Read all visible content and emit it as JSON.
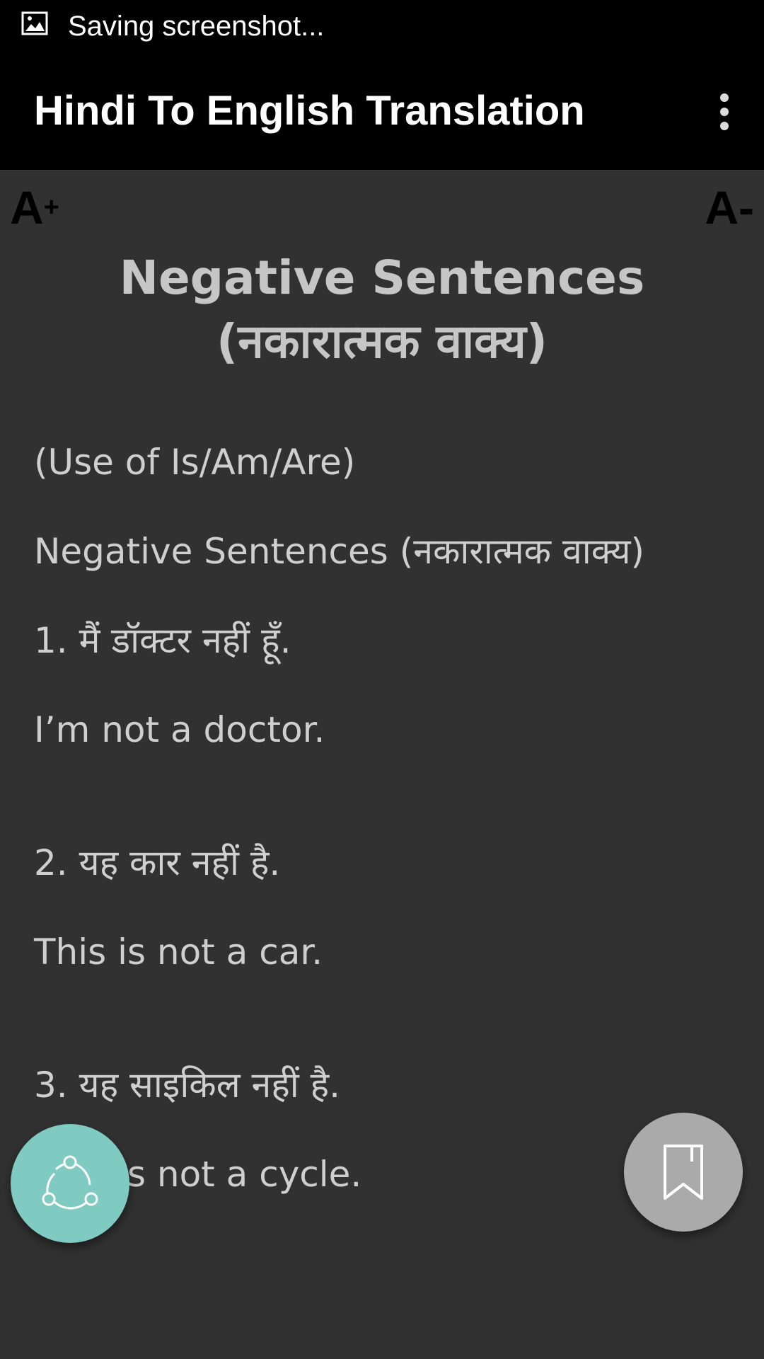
{
  "status_bar": {
    "text": "Saving screenshot...",
    "icon": "image-icon"
  },
  "app_bar": {
    "title": "Hindi To English Translation",
    "menu_icon": "more-vertical-icon"
  },
  "font_controls": {
    "increase_label": "A",
    "increase_symbol": "+",
    "decrease_label": "A-"
  },
  "content": {
    "title_line1": "Negative Sentences",
    "title_line2": "(नकारात्मक वाक्य)",
    "lines": [
      "(Use of Is/Am/Are)",
      "Negative Sentences (नकारात्मक वाक्य)",
      "1. मैं डॉक्टर नहीं हूँ.",
      "I’m not a doctor.",
      "2. यह कार नहीं है.",
      "This is not a car.",
      "3. यह साइकिल नहीं है.",
      "This is not a cycle."
    ]
  },
  "fabs": {
    "share_icon": "share-icon",
    "share_color": "#7fcbc1",
    "bookmark_icon": "bookmark-icon",
    "bookmark_color": "#aaaaaa"
  },
  "colors": {
    "background": "#313131",
    "bar": "#000000",
    "title_text": "#c6c6c6",
    "body_text": "#cfcfcf"
  }
}
